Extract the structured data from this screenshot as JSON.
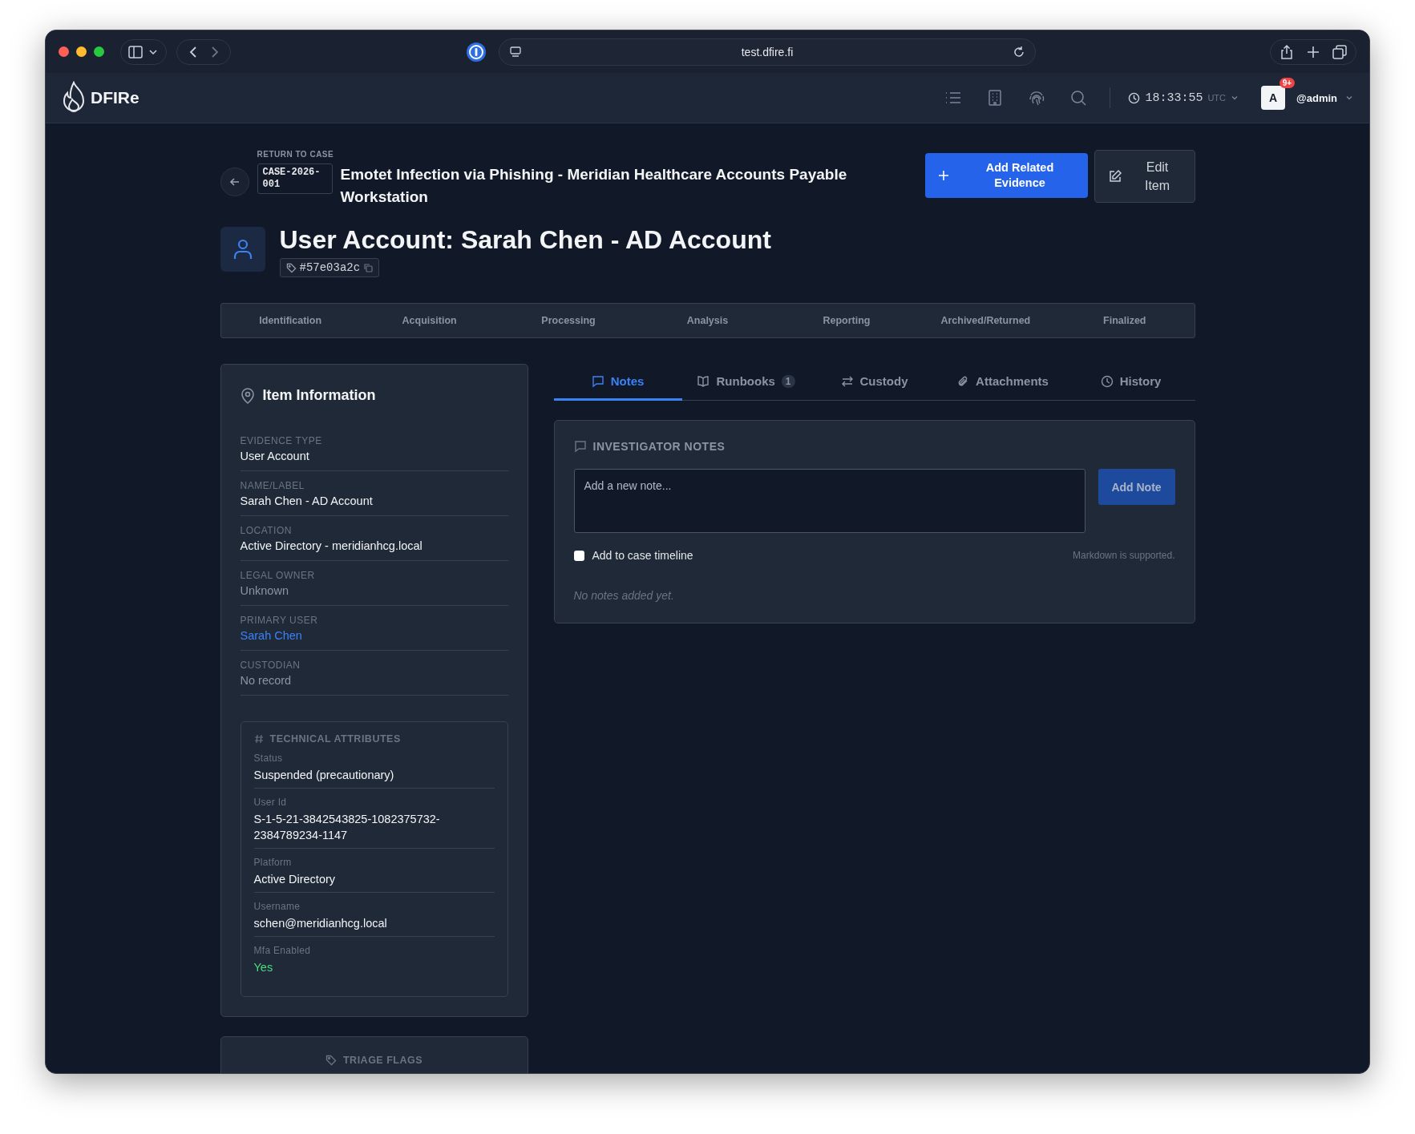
{
  "browser": {
    "url": "test.dfire.fi"
  },
  "app": {
    "brand": "DFIRe",
    "time": "18:33:55",
    "timezone": "UTC",
    "notification_count": "9+",
    "avatar_letter": "A",
    "username": "@admin"
  },
  "case": {
    "return_label": "RETURN TO CASE",
    "case_id": "CASE-2026-001",
    "case_title": "Emotet Infection via Phishing - Meridian Healthcare Accounts Payable Workstation"
  },
  "actions": [
    {
      "kind": "primary",
      "label": "Add Related Evidence"
    },
    {
      "kind": "secondary",
      "label": "Edit Item"
    }
  ],
  "item": {
    "title": "User Account: Sarah Chen - AD Account",
    "tag": "#57e03a2c"
  },
  "lifecycle": [
    "Identification",
    "Acquisition",
    "Processing",
    "Analysis",
    "Reporting",
    "Archived/Returned",
    "Finalized"
  ],
  "item_information": {
    "title": "Item Information",
    "fields": [
      {
        "label": "EVIDENCE TYPE",
        "value": "User Account",
        "kind": "plain"
      },
      {
        "label": "NAME/LABEL",
        "value": "Sarah Chen - AD Account",
        "kind": "plain"
      },
      {
        "label": "LOCATION",
        "value": "Active Directory - meridianhcg.local",
        "kind": "plain"
      },
      {
        "label": "LEGAL OWNER",
        "value": "Unknown",
        "kind": "muted"
      },
      {
        "label": "PRIMARY USER",
        "value": "Sarah Chen",
        "kind": "link"
      },
      {
        "label": "CUSTODIAN",
        "value": "No record",
        "kind": "muted"
      }
    ]
  },
  "technical_attributes": {
    "title": "TECHNICAL ATTRIBUTES",
    "fields": [
      {
        "label": "Status",
        "value": "Suspended (precautionary)",
        "kind": "plain"
      },
      {
        "label": "User Id",
        "value": "S-1-5-21-3842543825-1082375732-2384789234-1147",
        "kind": "plain"
      },
      {
        "label": "Platform",
        "value": "Active Directory",
        "kind": "plain"
      },
      {
        "label": "Username",
        "value": "schen@meridianhcg.local",
        "kind": "plain"
      },
      {
        "label": "Mfa Enabled",
        "value": "Yes",
        "kind": "success"
      }
    ]
  },
  "triage_flags": {
    "title": "TRIAGE FLAGS"
  },
  "tabs": [
    {
      "kind": "notes",
      "label": "Notes",
      "selected": true
    },
    {
      "kind": "runbooks",
      "label": "Runbooks",
      "count": "1",
      "selected": false
    },
    {
      "kind": "custody",
      "label": "Custody",
      "selected": false
    },
    {
      "kind": "attachments",
      "label": "Attachments",
      "selected": false
    },
    {
      "kind": "history",
      "label": "History",
      "selected": false
    }
  ],
  "notes": {
    "heading": "INVESTIGATOR NOTES",
    "placeholder": "Add a new note...",
    "button": "Add Note",
    "timeline": {
      "label": "Add to case timeline",
      "checked": false
    },
    "hint": "Markdown is supported.",
    "empty": "No notes added yet."
  }
}
